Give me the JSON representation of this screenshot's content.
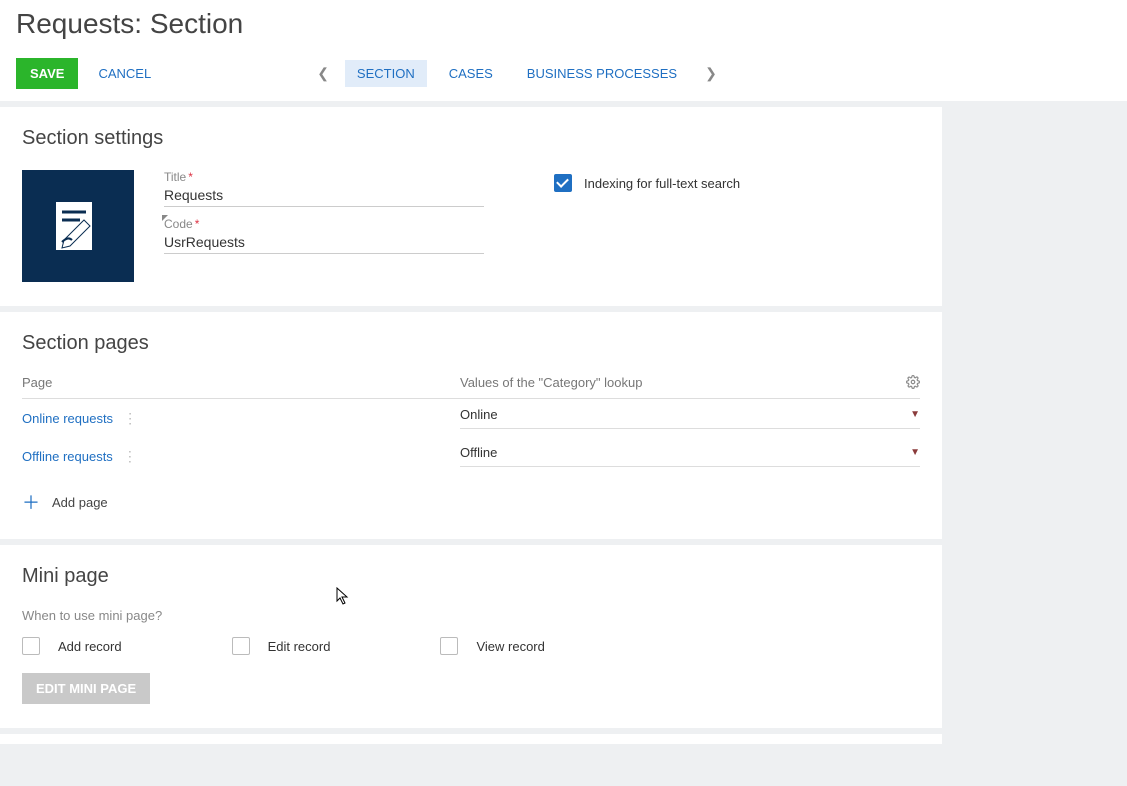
{
  "header": {
    "title": "Requests: Section",
    "save": "SAVE",
    "cancel": "CANCEL",
    "tabs": [
      "SECTION",
      "CASES",
      "BUSINESS PROCESSES"
    ],
    "active_tab": 0
  },
  "section_settings": {
    "title": "Section settings",
    "title_field_label": "Title",
    "title_field_value": "Requests",
    "code_field_label": "Code",
    "code_field_value": "UsrRequests",
    "indexing_label": "Indexing for full-text search",
    "indexing_checked": true
  },
  "section_pages": {
    "title": "Section pages",
    "col_page": "Page",
    "col_category": "Values of the \"Category\" lookup",
    "rows": [
      {
        "page": "Online requests",
        "category": "Online"
      },
      {
        "page": "Offline requests",
        "category": "Offline"
      }
    ],
    "add_page": "Add page"
  },
  "mini_page": {
    "title": "Mini page",
    "question": "When to use mini page?",
    "options": [
      "Add record",
      "Edit record",
      "View record"
    ],
    "edit_button": "EDIT MINI PAGE"
  }
}
